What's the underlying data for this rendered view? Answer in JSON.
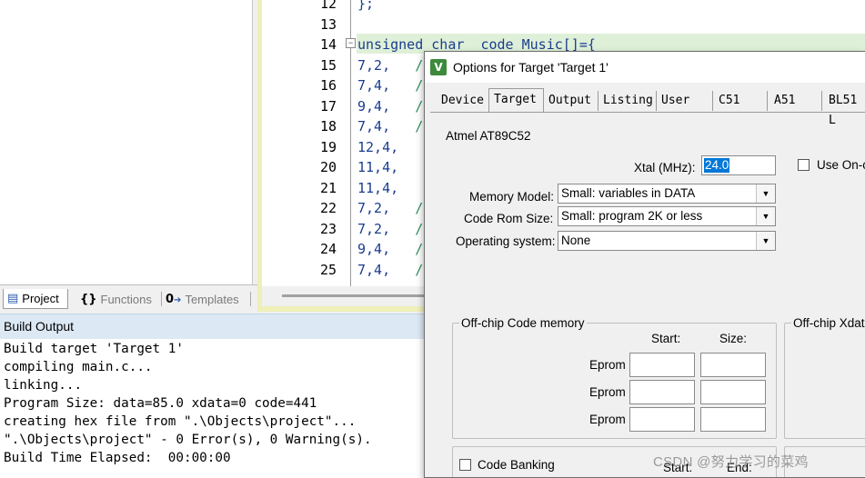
{
  "editor": {
    "lines": [
      {
        "num": "12",
        "code": "};",
        "comment": ""
      },
      {
        "num": "13",
        "code": "",
        "comment": ""
      },
      {
        "num": "14",
        "code": "unsigned char  code Music[]={",
        "comment": ""
      },
      {
        "num": "15",
        "code": "7,2,   ",
        "comment": "/"
      },
      {
        "num": "16",
        "code": "7,4,   ",
        "comment": "/"
      },
      {
        "num": "17",
        "code": "9,4,   ",
        "comment": "/"
      },
      {
        "num": "18",
        "code": "7,4,   ",
        "comment": "/"
      },
      {
        "num": "19",
        "code": "12,4,",
        "comment": ""
      },
      {
        "num": "20",
        "code": "11,4,",
        "comment": ""
      },
      {
        "num": "21",
        "code": "11,4,",
        "comment": ""
      },
      {
        "num": "22",
        "code": "7,2,   ",
        "comment": "/"
      },
      {
        "num": "23",
        "code": "7,2,   ",
        "comment": "/"
      },
      {
        "num": "24",
        "code": "9,4,   ",
        "comment": "/"
      },
      {
        "num": "25",
        "code": "7,4,   ",
        "comment": "/"
      }
    ]
  },
  "project_tabs": [
    {
      "label": "Project",
      "icon": "project-icon",
      "glyph": "▤"
    },
    {
      "label": "Functions",
      "icon": "functions-icon",
      "glyph": "{}"
    },
    {
      "label": "Templates",
      "icon": "templates-icon",
      "glyph": "0"
    }
  ],
  "build_output": {
    "title": "Build Output",
    "lines": [
      "Build target 'Target 1'",
      "compiling main.c...",
      "linking...",
      "Program Size: data=85.0 xdata=0 code=441",
      "creating hex file from \".\\Objects\\project\"...",
      "\".\\Objects\\project\" - 0 Error(s), 0 Warning(s).",
      "Build Time Elapsed:  00:00:00"
    ]
  },
  "dialog": {
    "title": "Options for Target 'Target 1'",
    "tabs": [
      "Device",
      "Target",
      "Output",
      "Listing",
      "User",
      "C51",
      "A51",
      "BL51 L"
    ],
    "active_tab": "Target",
    "device_name": "Atmel AT89C52",
    "xtal_label": "Xtal (MHz):",
    "xtal_value": "24.0",
    "use_onchip_label": "Use On-c",
    "memory_model_label": "Memory Model:",
    "memory_model_value": "Small: variables in DATA",
    "code_rom_label": "Code Rom Size:",
    "code_rom_value": "Small: program 2K or less",
    "os_label": "Operating system:",
    "os_value": "None",
    "offchip_code_title": "Off-chip Code memory",
    "offchip_xdata_title": "Off-chip Xdata",
    "start_label": "Start:",
    "size_label": "Size:",
    "eprom_label": "Eprom",
    "code_banking_label": "Code Banking",
    "bank_start_label": "Start:",
    "bank_end_label": "End:"
  },
  "watermark": "CSDN @努力学习的菜鸡"
}
